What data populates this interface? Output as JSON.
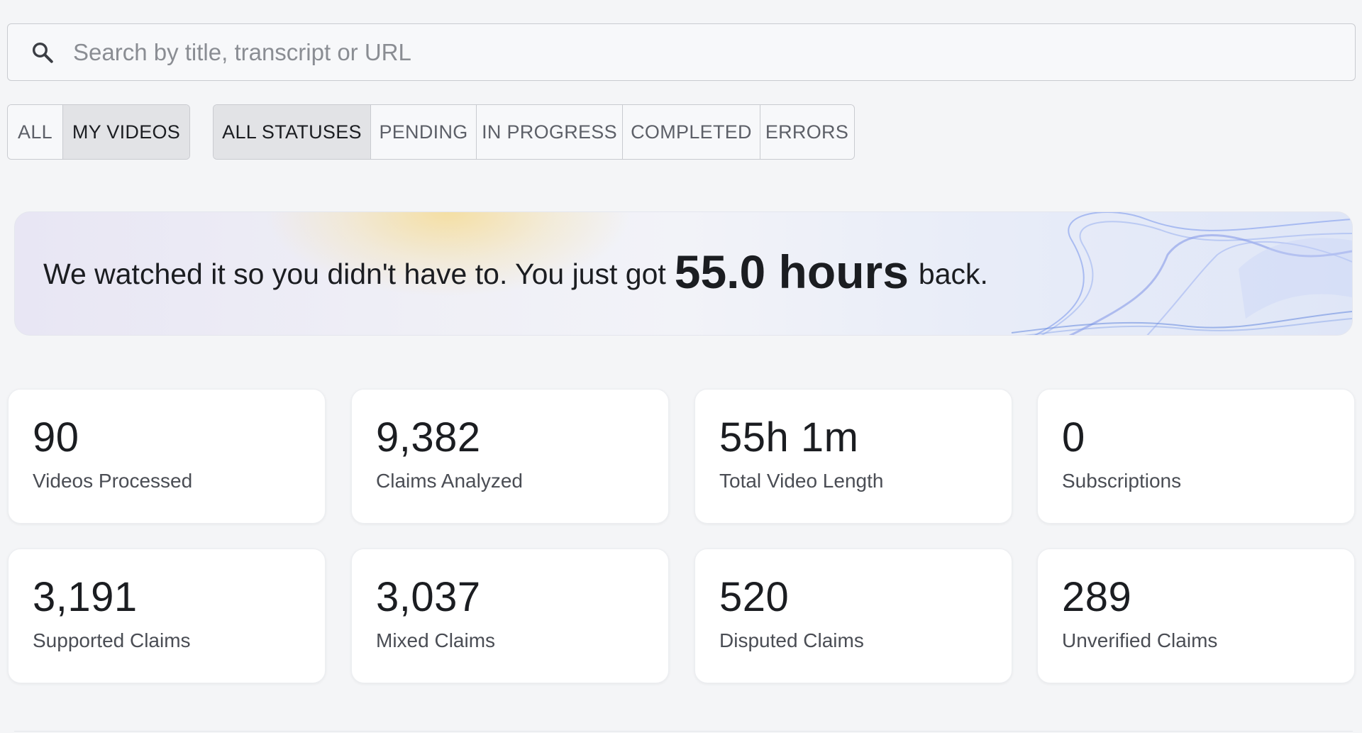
{
  "search": {
    "placeholder": "Search by title, transcript or URL",
    "icon": "search-icon"
  },
  "scope_filter": [
    {
      "label": "ALL",
      "active": false
    },
    {
      "label": "MY VIDEOS",
      "active": true
    }
  ],
  "status_filter": [
    {
      "label": "ALL STATUSES",
      "active": true
    },
    {
      "label": "PENDING",
      "active": false
    },
    {
      "label": "IN PROGRESS",
      "active": false
    },
    {
      "label": "COMPLETED",
      "active": false
    },
    {
      "label": "ERRORS",
      "active": false
    }
  ],
  "banner": {
    "lead": "We watched it so you didn't have to. You just got",
    "highlight": "55.0 hours",
    "tail": "back."
  },
  "stats": [
    {
      "value": "90",
      "label": "Videos Processed"
    },
    {
      "value": "9,382",
      "label": "Claims Analyzed"
    },
    {
      "value": "55h 1m",
      "label": "Total Video Length"
    },
    {
      "value": "0",
      "label": "Subscriptions"
    },
    {
      "value": "3,191",
      "label": "Supported Claims"
    },
    {
      "value": "3,037",
      "label": "Mixed Claims"
    },
    {
      "value": "520",
      "label": "Disputed Claims"
    },
    {
      "value": "289",
      "label": "Unverified Claims"
    }
  ],
  "colors": {
    "background": "#f4f5f7",
    "active_segment": "#e2e3e6",
    "card": "#ffffff",
    "banner_accent": "#f7d678",
    "wave": "#7f9be6"
  }
}
